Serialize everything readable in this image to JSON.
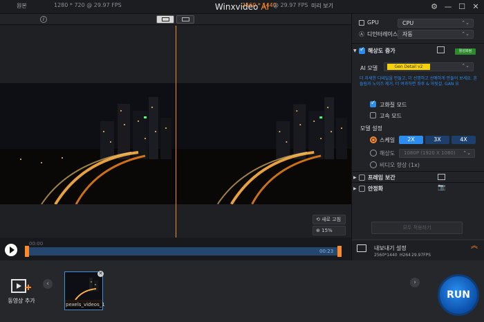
{
  "window": {
    "title": "Winxvideo",
    "title_ai": "AI",
    "controls": [
      "settings-icon",
      "minimize-icon",
      "maximize-icon",
      "close-icon"
    ]
  },
  "preview_header": {
    "original_label": "원본",
    "original_info": "1280 * 720 @ 29.97 FPS",
    "output_info": "2560 * 1440",
    "output_fps": "@ 29.97 FPS",
    "preview_label": "미리 보기"
  },
  "preview_tools": {
    "refresh_label": "새로 고침",
    "zoom_label": "15%"
  },
  "timeline": {
    "start_time": "00:00",
    "end_time": "00:23"
  },
  "panel": {
    "gpu_label": "GPU",
    "gpu_value": "CPU",
    "deinterlace_label": "디인터레이스",
    "deinterlace_value": "자동",
    "resolution_section": "해상도 증가",
    "enabled_badge": "활성화됨",
    "ai_model_label": "AI 모델",
    "ai_model_value": "Gen Detail v2",
    "model_description": "더 자세한 디테일을 만들고, 더 선명하고 선예하게 만들어 보세요. 흔들림과 노이즈 제거, 더 여과하면 좌후 & 아릿걸. GAN 요",
    "high_quality_label": "고화질 모드",
    "fast_mode_label": "고속 모드",
    "model_settings_label": "모델 설정",
    "scale_label": "스케일",
    "scale_options": [
      "2X",
      "3X",
      "4X"
    ],
    "resolution_label": "해상도",
    "resolution_value": "1080P (1920 X 1080)",
    "video_enhance_label": "비디오 향상 (1x)",
    "frame_interp_section": "프레임 보간",
    "stabilize_section": "안정화",
    "disabled_button": "모두 적용하기",
    "export_title": "내보내기 설정",
    "export_res": "2560*1440",
    "export_codec": "H264",
    "export_fps": "29.97FPS"
  },
  "bottom": {
    "add_video_label": "동영상 추가",
    "thumbnail_label": "pexels_videos_1",
    "run_label": "RUN"
  },
  "colors": {
    "accent": "#ff8a2a",
    "primary_blue": "#2c8cf0",
    "badge_green": "#2e8a2e",
    "tag_yellow": "#f5d20a"
  }
}
